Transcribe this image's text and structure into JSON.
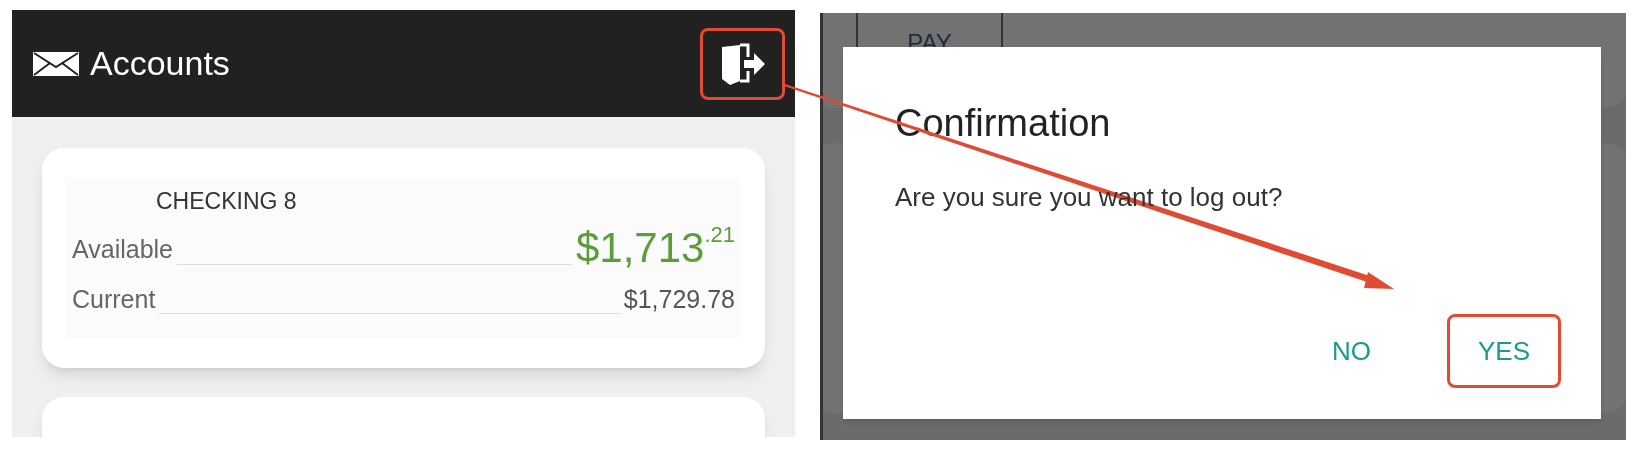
{
  "accounts_screen": {
    "header": {
      "title": "Accounts",
      "logout_highlighted": true
    },
    "accounts": [
      {
        "name": "CHECKING 8",
        "available_label": "Available",
        "available": "$1,713$^{.21}$",
        "current_label": "Current",
        "current": "$1,729.78"
      }
    ]
  },
  "background_buttons": [
    "PAY"
  ],
  "dialog": {
    "title": "Confirmation",
    "message": "Are you sure you want to log out?",
    "buttons": [
      {
        "label": "NO",
        "highlighted": false
      },
      {
        "label": "YES",
        "highlighted": true
      }
    ]
  }
}
